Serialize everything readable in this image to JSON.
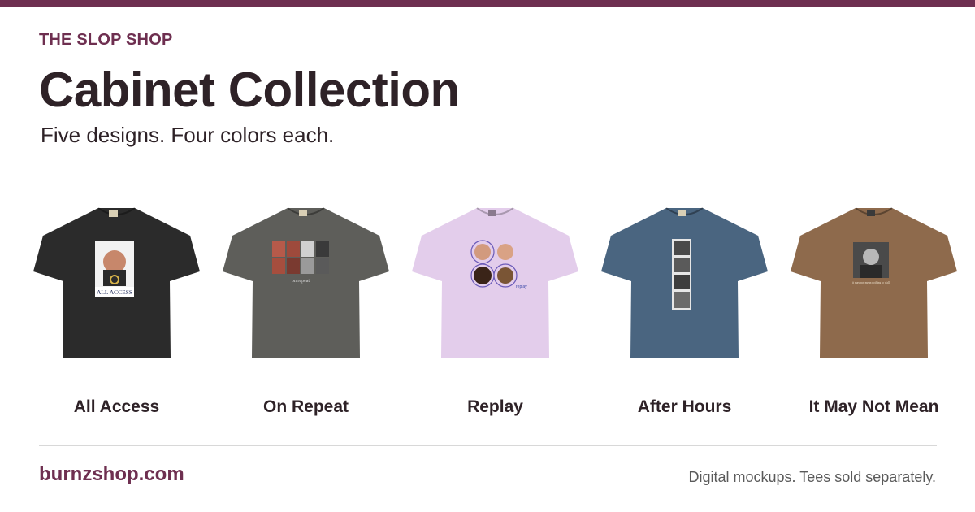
{
  "header": {
    "shop_name": "THE SLOP SHOP",
    "title": "Cabinet Collection",
    "subtitle": "Five designs. Four colors each."
  },
  "products": [
    {
      "label": "All Access",
      "tee_color": "#2b2b2b",
      "print_caption": "ALL ACCESS"
    },
    {
      "label": "On Repeat",
      "tee_color": "#5e5e5a",
      "print_caption": "on repeat"
    },
    {
      "label": "Replay",
      "tee_color": "#e3cdeb",
      "print_caption": "replay"
    },
    {
      "label": "After Hours",
      "tee_color": "#4a6580",
      "print_caption": ""
    },
    {
      "label": "It May Not Mean",
      "tee_color": "#8e6a4c",
      "print_caption": "it may not mean nothing to y'all"
    }
  ],
  "footer": {
    "site": "burnzshop.com",
    "disclaimer": "Digital mockups. Tees sold separately."
  },
  "colors": {
    "accent": "#6e2f50",
    "text": "#2e2227"
  }
}
